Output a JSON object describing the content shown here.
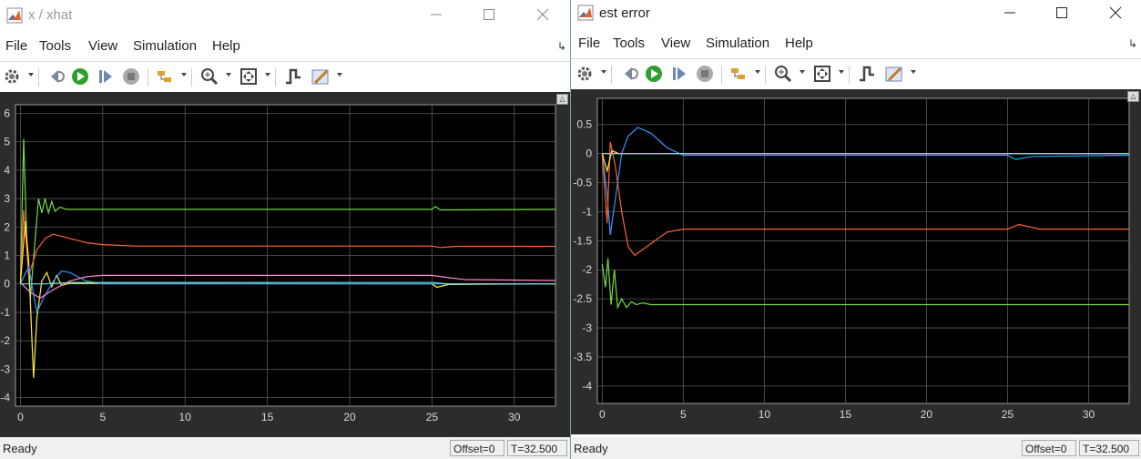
{
  "windows": [
    {
      "id": "left",
      "title": "x / xhat",
      "menu": [
        "File",
        "Tools",
        "View",
        "Simulation",
        "Help"
      ],
      "status": {
        "text": "Ready",
        "offset": "Offset=0",
        "time": "T=32.500"
      },
      "icons": {
        "app": "matlab-icon",
        "minimize": "minimize-icon",
        "maximize": "maximize-icon",
        "close": "close-icon"
      },
      "chart_data": {
        "type": "line",
        "title": "",
        "xlabel": "",
        "ylabel": "",
        "xlim": [
          -0.3,
          32.5
        ],
        "ylim": [
          -4.3,
          6.3
        ],
        "x_ticks": [
          0,
          5,
          10,
          15,
          20,
          25,
          30
        ],
        "y_ticks": [
          -4,
          -3,
          -2,
          -1,
          0,
          1,
          2,
          3,
          4,
          5,
          6
        ],
        "grid": true,
        "background": "#000000",
        "series": [
          {
            "color": "#77dd44",
            "points": [
              [
                0,
                0
              ],
              [
                0.2,
                5.1
              ],
              [
                0.4,
                1.2
              ],
              [
                0.6,
                -0.5
              ],
              [
                0.9,
                1.6
              ],
              [
                1.1,
                3.0
              ],
              [
                1.3,
                2.5
              ],
              [
                1.5,
                3.0
              ],
              [
                1.7,
                2.5
              ],
              [
                1.9,
                2.9
              ],
              [
                2.1,
                2.55
              ],
              [
                2.4,
                2.7
              ],
              [
                2.8,
                2.62
              ],
              [
                25,
                2.62
              ],
              [
                25.2,
                2.72
              ],
              [
                25.5,
                2.6
              ],
              [
                32.5,
                2.62
              ]
            ]
          },
          {
            "color": "#ff6633",
            "points": [
              [
                0,
                0
              ],
              [
                0.2,
                2.6
              ],
              [
                0.5,
                0.3
              ],
              [
                1.0,
                1.2
              ],
              [
                1.5,
                1.6
              ],
              [
                2,
                1.75
              ],
              [
                3,
                1.6
              ],
              [
                4,
                1.45
              ],
              [
                5,
                1.38
              ],
              [
                7,
                1.33
              ],
              [
                25,
                1.33
              ],
              [
                25.5,
                1.28
              ],
              [
                26.5,
                1.32
              ],
              [
                32.5,
                1.32
              ]
            ]
          },
          {
            "color": "#ffee44",
            "points": [
              [
                0,
                0
              ],
              [
                0.3,
                2.2
              ],
              [
                0.5,
                0.8
              ],
              [
                0.7,
                -2.0
              ],
              [
                0.8,
                -3.3
              ],
              [
                1.0,
                -1.2
              ],
              [
                1.3,
                0.1
              ],
              [
                1.6,
                0.4
              ],
              [
                1.9,
                -0.1
              ],
              [
                2.2,
                0.3
              ],
              [
                2.5,
                -0.05
              ],
              [
                3,
                0.02
              ],
              [
                25,
                0.0
              ],
              [
                25.3,
                -0.12
              ],
              [
                26,
                -0.02
              ],
              [
                32.5,
                0.0
              ]
            ]
          },
          {
            "color": "#3399ff",
            "points": [
              [
                0,
                0
              ],
              [
                0.5,
                0.6
              ],
              [
                1.0,
                -1.0
              ],
              [
                1.4,
                -0.5
              ],
              [
                2,
                0.1
              ],
              [
                2.5,
                0.45
              ],
              [
                3,
                0.4
              ],
              [
                4,
                0.1
              ],
              [
                5,
                0.0
              ],
              [
                32.5,
                0.0
              ]
            ]
          },
          {
            "color": "#ff88cc",
            "points": [
              [
                0,
                0.05
              ],
              [
                0.6,
                -0.3
              ],
              [
                1.2,
                -0.5
              ],
              [
                2,
                -0.2
              ],
              [
                3,
                0.1
              ],
              [
                4,
                0.25
              ],
              [
                5,
                0.3
              ],
              [
                25,
                0.3
              ],
              [
                26,
                0.22
              ],
              [
                27,
                0.15
              ],
              [
                32.5,
                0.12
              ]
            ]
          },
          {
            "color": "#66dddd",
            "points": [
              [
                0,
                0
              ],
              [
                1.5,
                0.0
              ],
              [
                3,
                0.05
              ],
              [
                25,
                0.05
              ],
              [
                26,
                0.0
              ],
              [
                32.5,
                0.0
              ]
            ]
          }
        ]
      }
    },
    {
      "id": "right",
      "title": "est error",
      "menu": [
        "File",
        "Tools",
        "View",
        "Simulation",
        "Help"
      ],
      "status": {
        "text": "Ready",
        "offset": "Offset=0",
        "time": "T=32.500"
      },
      "icons": {
        "app": "matlab-icon",
        "minimize": "minimize-icon",
        "maximize": "maximize-icon",
        "close": "close-icon"
      },
      "chart_data": {
        "type": "line",
        "title": "",
        "xlabel": "",
        "ylabel": "",
        "xlim": [
          -0.3,
          32.5
        ],
        "ylim": [
          -4.3,
          0.95
        ],
        "x_ticks": [
          0,
          5,
          10,
          15,
          20,
          25,
          30
        ],
        "y_ticks": [
          -4,
          -3.5,
          -3,
          -2.5,
          -2,
          -1.5,
          -1,
          -0.5,
          0,
          0.5
        ],
        "y_tick_labels": [
          "-4",
          "-3.5",
          "-3",
          "-2.5",
          "-2",
          "-1.5",
          "-1",
          "-0.5",
          "0",
          "0.5"
        ],
        "grid": true,
        "background": "#000000",
        "series": [
          {
            "color": "#3399ff",
            "points": [
              [
                0,
                0
              ],
              [
                0.3,
                -0.7
              ],
              [
                0.5,
                -1.4
              ],
              [
                0.8,
                -0.8
              ],
              [
                1.2,
                0.0
              ],
              [
                1.6,
                0.3
              ],
              [
                2.2,
                0.45
              ],
              [
                3,
                0.35
              ],
              [
                4,
                0.1
              ],
              [
                5,
                -0.03
              ],
              [
                8,
                -0.03
              ],
              [
                25,
                -0.03
              ],
              [
                25.5,
                -0.1
              ],
              [
                26.5,
                -0.05
              ],
              [
                32.5,
                -0.03
              ]
            ]
          },
          {
            "color": "#ff6633",
            "points": [
              [
                0,
                0
              ],
              [
                0.3,
                -1.2
              ],
              [
                0.5,
                0.2
              ],
              [
                0.8,
                -0.2
              ],
              [
                1.2,
                -1.0
              ],
              [
                1.6,
                -1.6
              ],
              [
                2,
                -1.75
              ],
              [
                3,
                -1.55
              ],
              [
                4,
                -1.35
              ],
              [
                5,
                -1.3
              ],
              [
                8,
                -1.3
              ],
              [
                25,
                -1.3
              ],
              [
                25.7,
                -1.22
              ],
              [
                27,
                -1.3
              ],
              [
                32.5,
                -1.3
              ]
            ]
          },
          {
            "color": "#77dd44",
            "points": [
              [
                0,
                -1.9
              ],
              [
                0.2,
                -2.3
              ],
              [
                0.35,
                -1.8
              ],
              [
                0.55,
                -2.6
              ],
              [
                0.75,
                -2.0
              ],
              [
                0.95,
                -2.65
              ],
              [
                1.2,
                -2.5
              ],
              [
                1.5,
                -2.65
              ],
              [
                1.8,
                -2.55
              ],
              [
                2.1,
                -2.6
              ],
              [
                2.5,
                -2.57
              ],
              [
                3,
                -2.6
              ],
              [
                32.5,
                -2.6
              ]
            ]
          },
          {
            "color": "#ffee44",
            "points": [
              [
                0,
                0
              ],
              [
                0.3,
                -0.3
              ],
              [
                0.6,
                0.05
              ],
              [
                1,
                0.0
              ],
              [
                32.5,
                0.0
              ]
            ]
          },
          {
            "color": "#ff88cc",
            "points": [
              [
                0,
                0
              ],
              [
                32.5,
                0.0
              ]
            ]
          },
          {
            "color": "#66dddd",
            "points": [
              [
                0,
                0
              ],
              [
                32.5,
                0.0
              ]
            ]
          }
        ]
      }
    }
  ]
}
